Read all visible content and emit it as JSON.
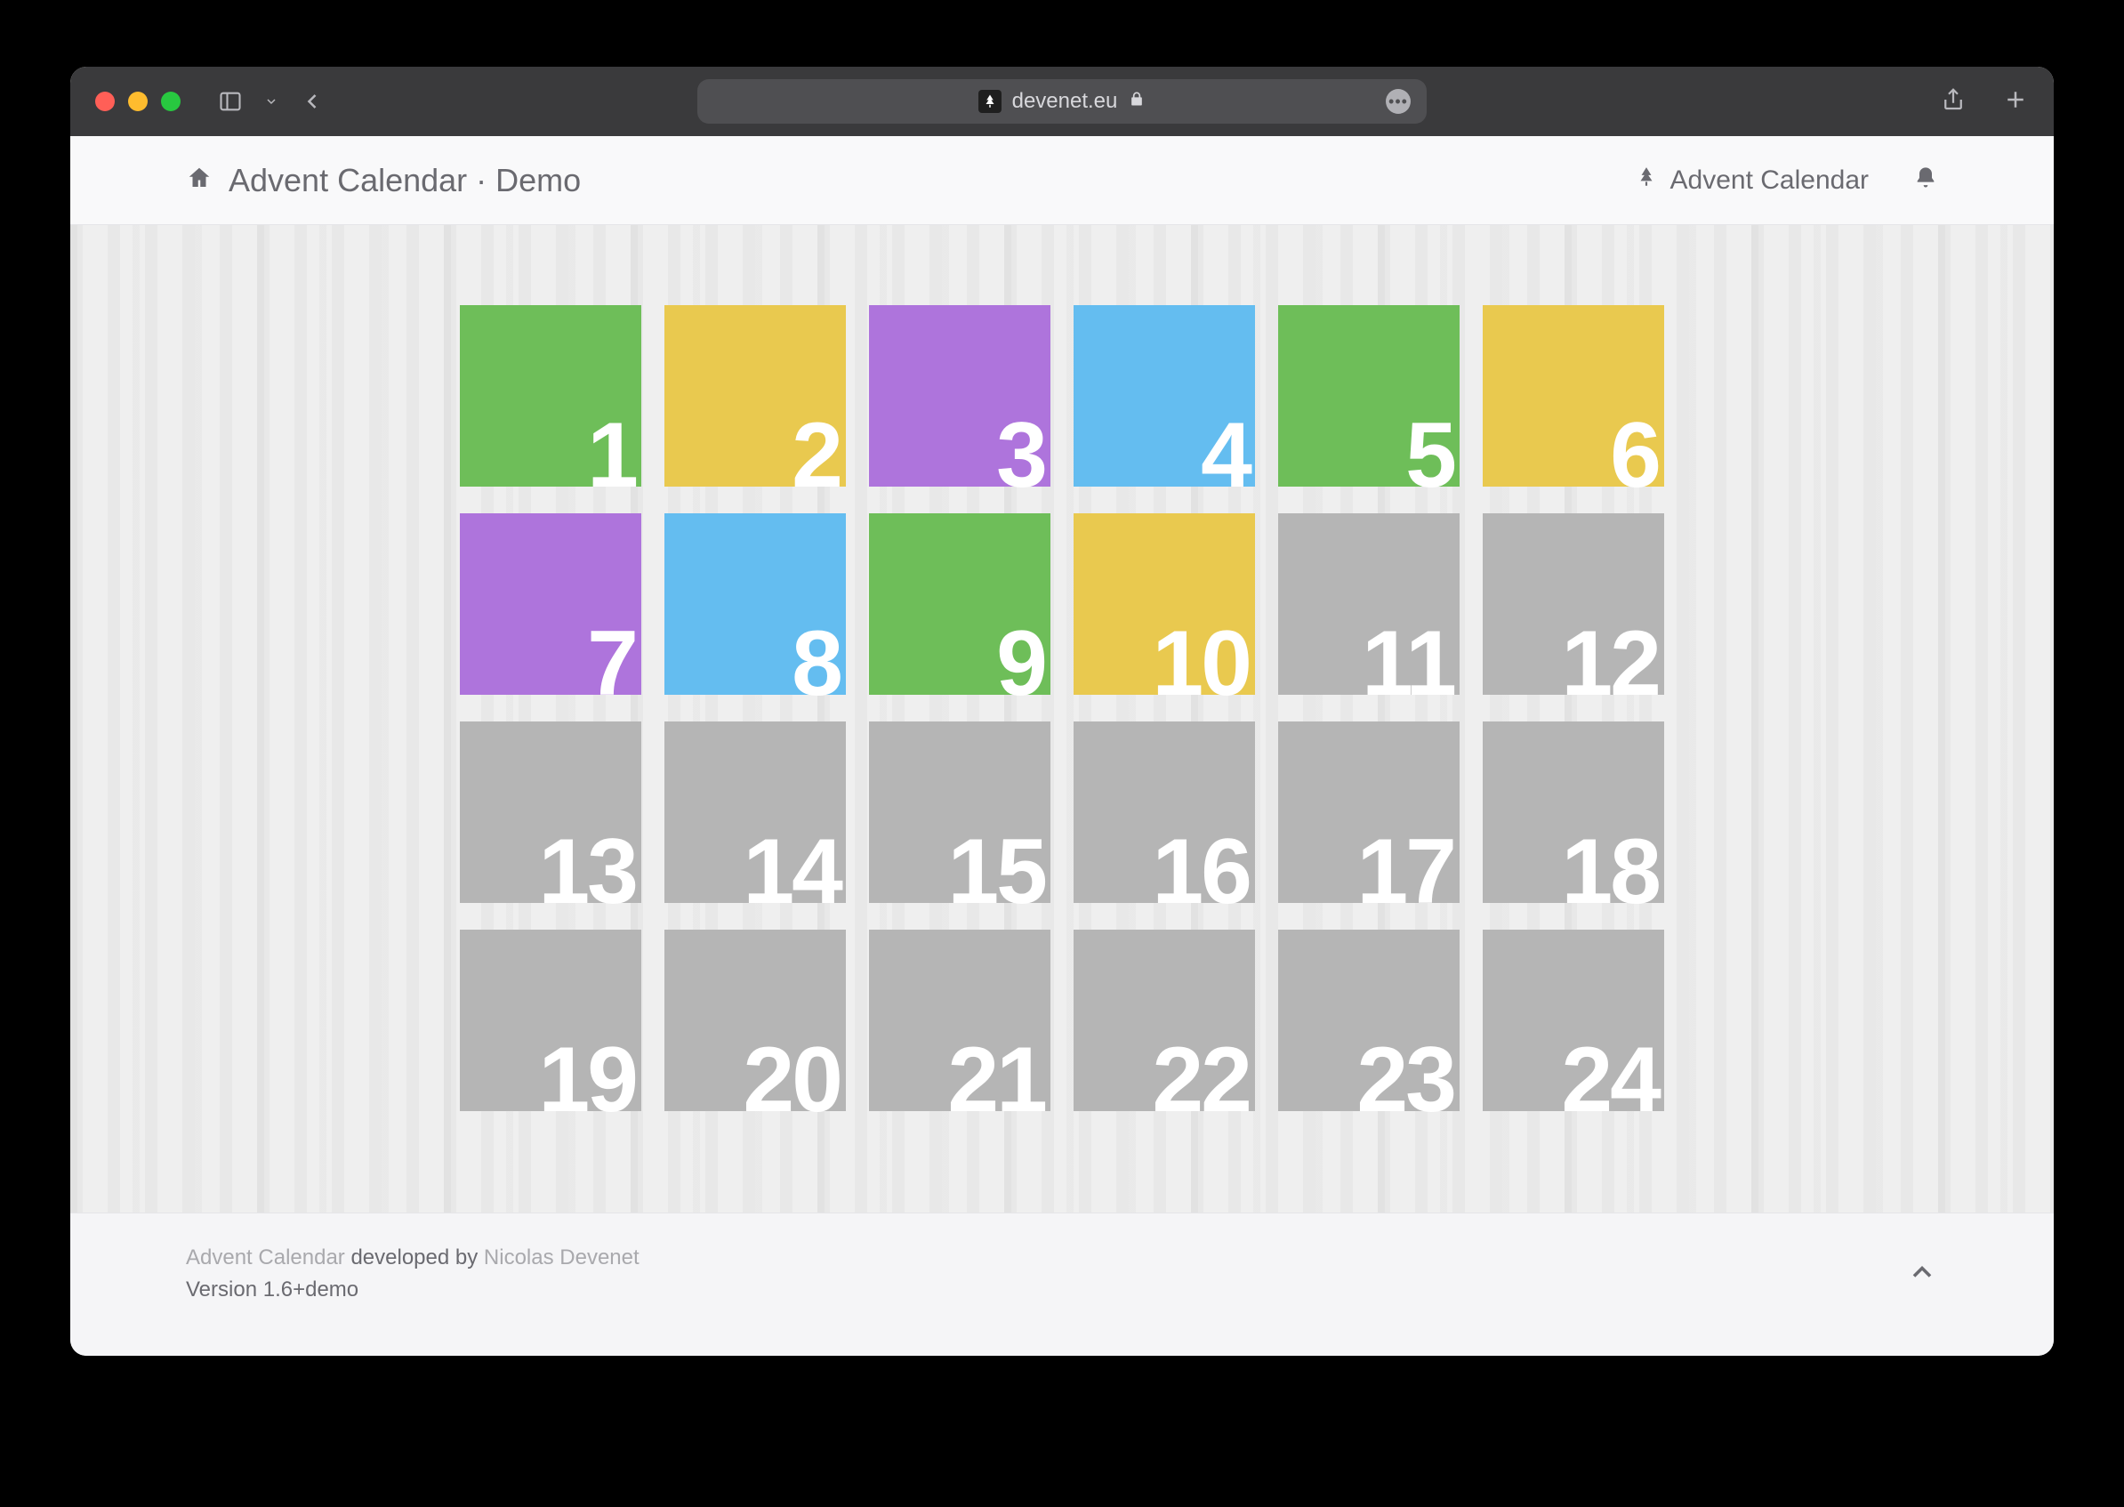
{
  "browser": {
    "domain": "devenet.eu"
  },
  "header": {
    "title": "Advent Calendar · Demo",
    "right_link": "Advent Calendar"
  },
  "days": [
    {
      "n": "1",
      "color": "green"
    },
    {
      "n": "2",
      "color": "yellow"
    },
    {
      "n": "3",
      "color": "purple"
    },
    {
      "n": "4",
      "color": "blue"
    },
    {
      "n": "5",
      "color": "green"
    },
    {
      "n": "6",
      "color": "yellow"
    },
    {
      "n": "7",
      "color": "purple"
    },
    {
      "n": "8",
      "color": "blue"
    },
    {
      "n": "9",
      "color": "green"
    },
    {
      "n": "10",
      "color": "yellow"
    },
    {
      "n": "11",
      "color": "gray"
    },
    {
      "n": "12",
      "color": "gray"
    },
    {
      "n": "13",
      "color": "gray"
    },
    {
      "n": "14",
      "color": "gray"
    },
    {
      "n": "15",
      "color": "gray"
    },
    {
      "n": "16",
      "color": "gray"
    },
    {
      "n": "17",
      "color": "gray"
    },
    {
      "n": "18",
      "color": "gray"
    },
    {
      "n": "19",
      "color": "gray"
    },
    {
      "n": "20",
      "color": "gray"
    },
    {
      "n": "21",
      "color": "gray"
    },
    {
      "n": "22",
      "color": "gray"
    },
    {
      "n": "23",
      "color": "gray"
    },
    {
      "n": "24",
      "color": "gray"
    }
  ],
  "footer": {
    "app_name": "Advent Calendar",
    "developed_by_text": "developed by",
    "author": "Nicolas Devenet",
    "version_label": "Version",
    "version": "1.6+demo"
  },
  "colors": {
    "green": "#6ebe59",
    "yellow": "#e9c94f",
    "purple": "#ae74dc",
    "blue": "#64bdf0",
    "gray": "#b5b5b5"
  }
}
